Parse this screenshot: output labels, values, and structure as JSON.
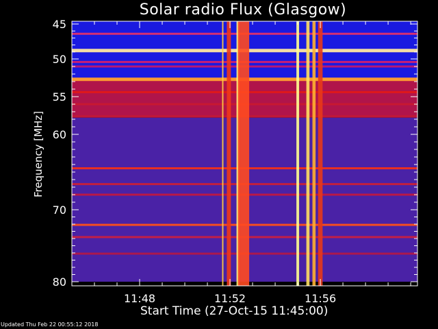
{
  "chart_data": {
    "type": "heatmap",
    "title": "Solar radio Flux (Glasgow)",
    "xlabel": "Start Time (27-Oct-15 11:45:00)",
    "ylabel": "Frequency [MHz]",
    "footer": "Updated Thu Feb 22 00:55:12 2018",
    "x_range_minutes": [
      45,
      60.3
    ],
    "y_range_mhz": [
      45,
      80
    ],
    "xticks": [
      {
        "minute": 48,
        "label": "11:48"
      },
      {
        "minute": 52,
        "label": "11:52"
      },
      {
        "minute": 56,
        "label": "11:56"
      }
    ],
    "yticks": [
      {
        "value": 45,
        "label": "45"
      },
      {
        "value": 50,
        "label": "50"
      },
      {
        "value": 55,
        "label": "55"
      },
      {
        "value": 60,
        "label": "60"
      },
      {
        "value": 70,
        "label": "70"
      },
      {
        "value": 80,
        "label": "80"
      }
    ],
    "background_bands": [
      {
        "from": 45,
        "to": 52.6,
        "color": "#1a1ae0"
      },
      {
        "from": 52.6,
        "to": 57.8,
        "color": "#b0144a"
      },
      {
        "from": 57.8,
        "to": 80,
        "color": "#4a22a6"
      }
    ],
    "horizontal_lines": [
      {
        "freq": 46.4,
        "color": "#e0306a"
      },
      {
        "freq": 48.8,
        "color": "#ffe8a0"
      },
      {
        "freq": 50.4,
        "color": "#d02070"
      },
      {
        "freq": 51.0,
        "color": "#c01870"
      },
      {
        "freq": 52.7,
        "color": "#ffa030"
      },
      {
        "freq": 54.4,
        "color": "#e01818"
      },
      {
        "freq": 56.0,
        "color": "#c81830"
      },
      {
        "freq": 57.6,
        "color": "#c01838"
      },
      {
        "freq": 64.5,
        "color": "#f03018"
      },
      {
        "freq": 66.6,
        "color": "#c82038"
      },
      {
        "freq": 68.0,
        "color": "#c01840"
      },
      {
        "freq": 72.1,
        "color": "#ff5018"
      },
      {
        "freq": 73.8,
        "color": "#c82040"
      },
      {
        "freq": 76.1,
        "color": "#b01848"
      }
    ],
    "burst_columns": [
      {
        "minute": 51.68,
        "width_min": 0.05,
        "color": "#ffcc40"
      },
      {
        "minute": 51.95,
        "width_min": 0.18,
        "color": "#f03818"
      },
      {
        "minute": 52.35,
        "width_min": 0.12,
        "color": "#ffff80"
      },
      {
        "minute": 52.6,
        "width_min": 0.5,
        "color": "#ff4a20"
      },
      {
        "minute": 55.0,
        "width_min": 0.12,
        "color": "#ffff90"
      },
      {
        "minute": 55.45,
        "width_min": 0.14,
        "color": "#ffe060"
      },
      {
        "minute": 55.72,
        "width_min": 0.14,
        "color": "#ffb030"
      },
      {
        "minute": 56.0,
        "width_min": 0.2,
        "color": "#e83818"
      }
    ]
  }
}
